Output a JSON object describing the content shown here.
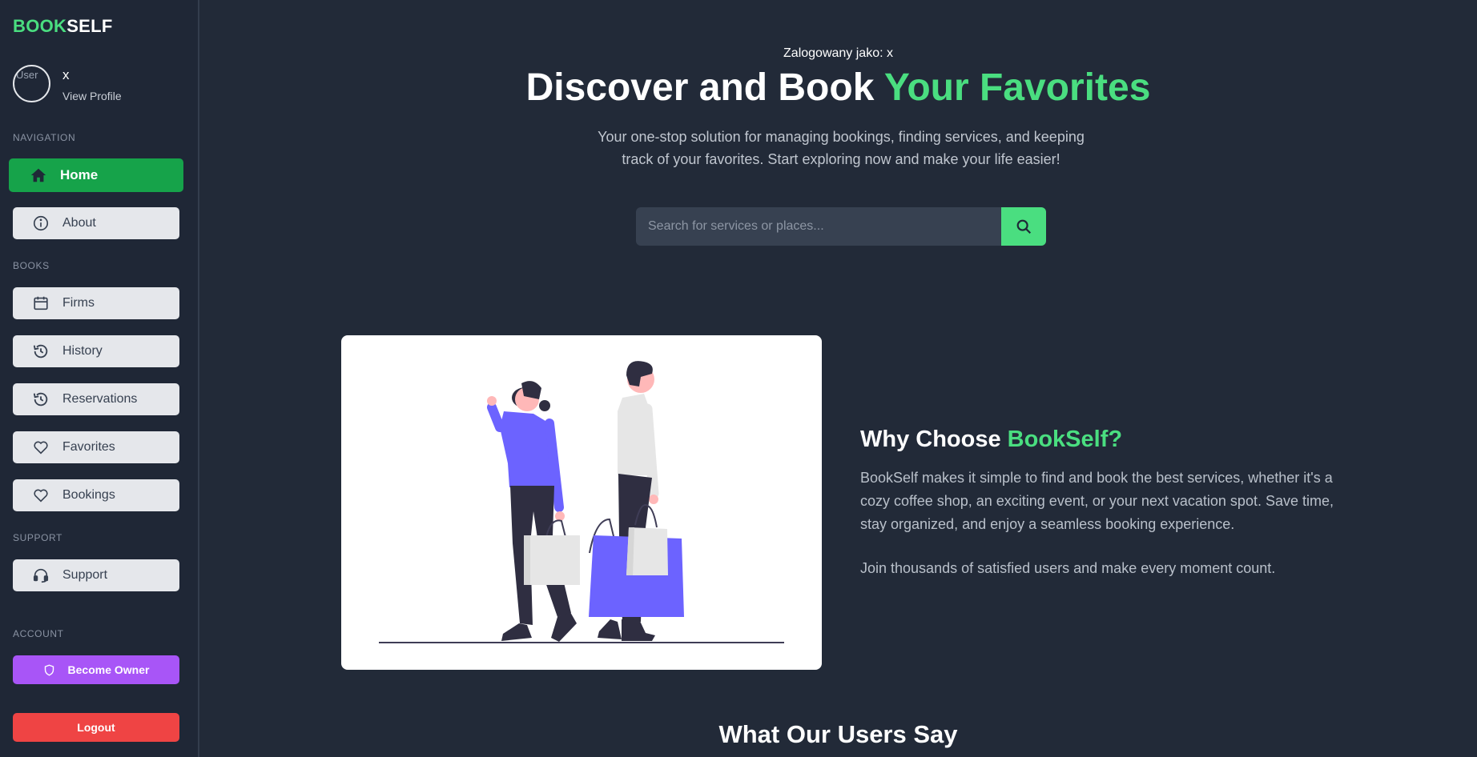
{
  "app": {
    "logo_part1": "BOOK",
    "logo_part2": "SELF"
  },
  "profile": {
    "avatar_alt": "User",
    "name": "x",
    "link": "View Profile"
  },
  "sidebar": {
    "navigation_heading": "NAVIGATION",
    "books_heading": "BOOKS",
    "support_heading": "SUPPORT",
    "account_heading": "ACCOUNT",
    "items": [
      {
        "label": "Home",
        "icon": "home-icon",
        "active": true
      },
      {
        "label": "About",
        "icon": "info-icon"
      },
      {
        "label": "Firms",
        "icon": "calendar-icon"
      },
      {
        "label": "History",
        "icon": "history-icon"
      },
      {
        "label": "Reservations",
        "icon": "history-icon"
      },
      {
        "label": "Favorites",
        "icon": "heart-icon"
      },
      {
        "label": "Bookings",
        "icon": "heart-icon"
      },
      {
        "label": "Support",
        "icon": "headset-icon"
      }
    ],
    "become_owner": "Become Owner",
    "logout": "Logout"
  },
  "hero": {
    "logged_in": "Zalogowany jako: x",
    "title_part1": "Discover and Book ",
    "title_part2": "Your Favorites",
    "subtitle": "Your one-stop solution for managing bookings, finding services, and keeping track of your favorites. Start exploring now and make your life easier!"
  },
  "search": {
    "placeholder": "Search for services or places...",
    "icon": "search-icon"
  },
  "why": {
    "title_part1": "Why Choose ",
    "title_part2": "BookSelf?",
    "paragraph1": "BookSelf makes it simple to find and book the best services, whether it's a cozy coffee shop, an exciting event, or your next vacation spot. Save time, stay organized, and enjoy a seamless booking experience.",
    "paragraph2": "Join thousands of satisfied users and make every moment count."
  },
  "testimonials": {
    "title": "What Our Users Say"
  },
  "colors": {
    "accent": "#4ade80",
    "active_nav": "#16a34a",
    "owner_button": "#a855f7",
    "logout_button": "#ef4444",
    "background": "#222a38"
  }
}
